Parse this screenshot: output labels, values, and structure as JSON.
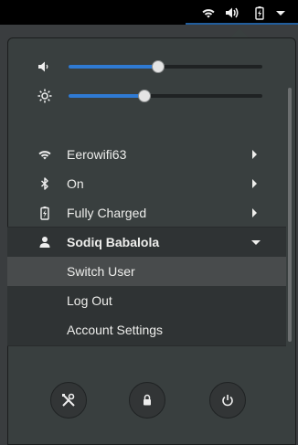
{
  "topbar": {
    "tray_icons": [
      "wifi-icon",
      "volume-icon",
      "battery-charging-icon",
      "dropdown-arrow-icon"
    ]
  },
  "menu": {
    "sliders": [
      {
        "name": "volume",
        "icon": "volume-icon",
        "level": 0.46
      },
      {
        "name": "brightness",
        "icon": "brightness-icon",
        "level": 0.39
      }
    ],
    "items": [
      {
        "label": "Eerowifi63",
        "icon": "wifi-icon"
      },
      {
        "label": "On",
        "icon": "bluetooth-icon"
      },
      {
        "label": "Fully Charged",
        "icon": "battery-charging-icon"
      }
    ],
    "user": {
      "name": "Sodiq Babalola",
      "icon": "user-icon",
      "submenu": [
        "Switch User",
        "Log Out",
        "Account Settings"
      ]
    },
    "actions": [
      {
        "icon": "settings-tools-icon"
      },
      {
        "icon": "lock-icon"
      },
      {
        "icon": "power-icon"
      }
    ]
  },
  "colors": {
    "menu_bg": "#393f3f",
    "accent": "#2f7ad3",
    "text": "#eeeeec"
  }
}
